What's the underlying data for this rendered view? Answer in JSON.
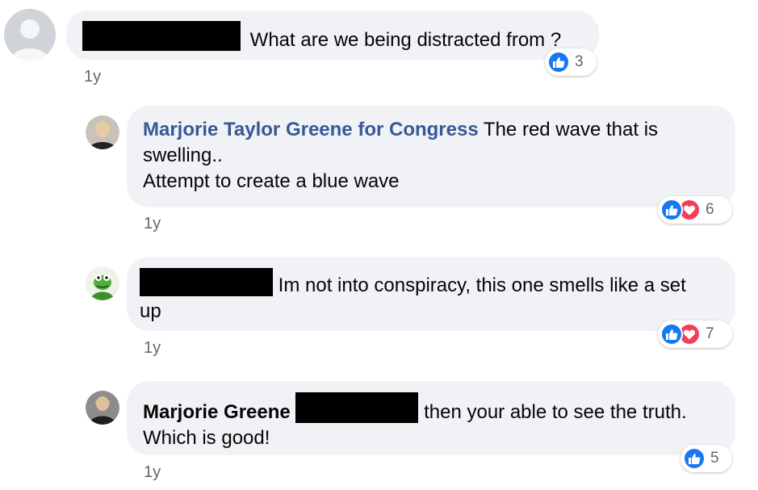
{
  "comments": [
    {
      "author": "",
      "text": "What are we being distracted from ?",
      "time": "1y",
      "reactions": [
        "like-icon"
      ],
      "reaction_count": "3"
    },
    {
      "author": "Marjorie Taylor Greene for Congress",
      "text_line1": "The red wave that is",
      "text_line2": "swelling..",
      "text_line3": "Attempt to create a blue wave",
      "time": "1y",
      "reactions": [
        "like-icon",
        "love-icon"
      ],
      "reaction_count": "6"
    },
    {
      "author": "",
      "text_line1": "Im not into conspiracy, this one smells like a set",
      "text_line2": "up",
      "time": "1y",
      "reactions": [
        "like-icon",
        "love-icon"
      ],
      "reaction_count": "7"
    },
    {
      "author": "Marjorie Greene",
      "text_line1": "then your able to see the truth.",
      "text_line2": "Which is good!",
      "time": "1y",
      "reactions": [
        "like-icon"
      ],
      "reaction_count": "5"
    }
  ],
  "colors": {
    "bubble": "#f0f2f5",
    "author_link": "#385898",
    "like": "#1877f2",
    "love": "#f33e58",
    "redaction": "#000000"
  }
}
